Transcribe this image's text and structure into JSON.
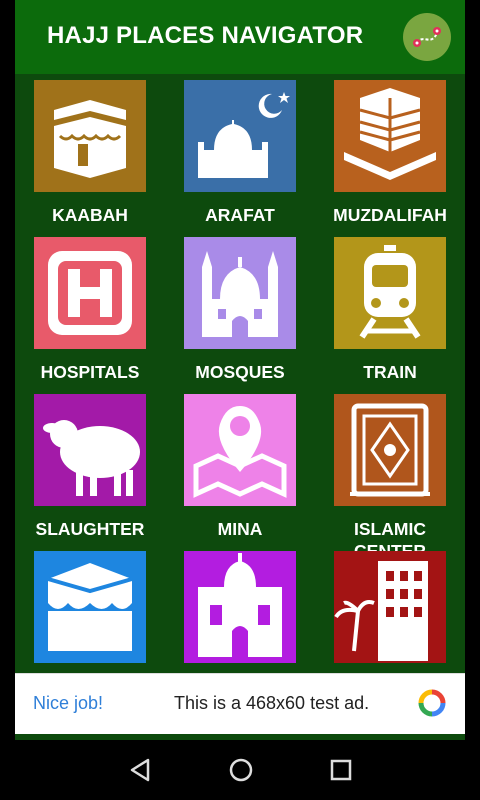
{
  "app": {
    "title": "HAJJ PLACES NAVIGATOR"
  },
  "tiles": [
    {
      "label": "KAABAH",
      "color": "#a0721a",
      "icon": "kaaba-icon"
    },
    {
      "label": "ARAFAT",
      "color": "#3a6fa8",
      "icon": "arafat-icon"
    },
    {
      "label": "MUZDALIFAH",
      "color": "#b8611e",
      "icon": "building-icon"
    },
    {
      "label": "HOSPITALS",
      "color": "#e85a6a",
      "icon": "hospital-icon"
    },
    {
      "label": "MOSQUES",
      "color": "#a98be8",
      "icon": "mosque-icon"
    },
    {
      "label": "TRAIN",
      "color": "#b3961a",
      "icon": "train-icon"
    },
    {
      "label": "SLAUGHTER",
      "color": "#a31aa8",
      "icon": "sheep-icon"
    },
    {
      "label": "MINA",
      "color": "#ee82e8",
      "icon": "map-pin-icon"
    },
    {
      "label": "ISLAMIC\nCENTER",
      "color": "#b0561c",
      "icon": "quran-icon"
    },
    {
      "label": "",
      "color": "#1e86e0",
      "icon": "kaaba-cloth-icon"
    },
    {
      "label": "",
      "color": "#b31de0",
      "icon": "palace-icon"
    },
    {
      "label": "",
      "color": "#a31414",
      "icon": "hotel-icon"
    }
  ],
  "ad": {
    "left_text": "Nice job!",
    "main_text": "This is a 468x60 test ad."
  }
}
